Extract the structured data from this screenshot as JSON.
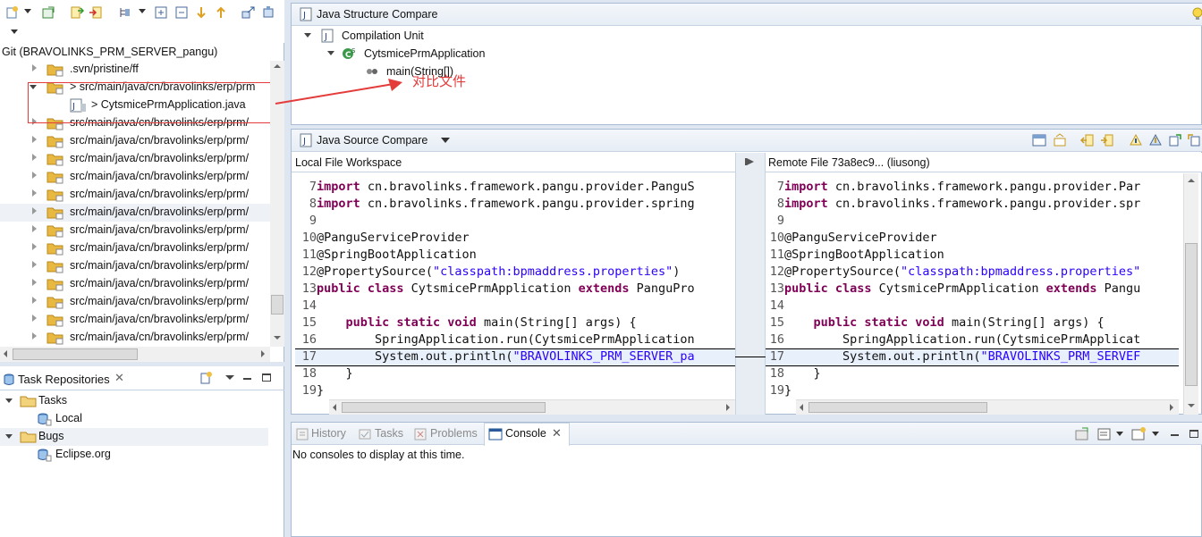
{
  "explorer": {
    "git_title": "Git (BRAVOLINKS_PRM_SERVER_pangu)",
    "rows": [
      {
        "label": ".svn/pristine/ff",
        "expanded": false
      },
      {
        "label": "> src/main/java/cn/bravolinks/erp/prm",
        "expanded": true
      },
      {
        "label": "> CytsmicePrmApplication.java",
        "expanded": false
      },
      {
        "label": "src/main/java/cn/bravolinks/erp/prm/",
        "expanded": false
      },
      {
        "label": "src/main/java/cn/bravolinks/erp/prm/",
        "expanded": false
      },
      {
        "label": "src/main/java/cn/bravolinks/erp/prm/",
        "expanded": false
      },
      {
        "label": "src/main/java/cn/bravolinks/erp/prm/",
        "expanded": false
      },
      {
        "label": "src/main/java/cn/bravolinks/erp/prm/",
        "expanded": false
      },
      {
        "label": "src/main/java/cn/bravolinks/erp/prm/",
        "expanded": false
      },
      {
        "label": "src/main/java/cn/bravolinks/erp/prm/",
        "expanded": false
      },
      {
        "label": "src/main/java/cn/bravolinks/erp/prm/",
        "expanded": false
      },
      {
        "label": "src/main/java/cn/bravolinks/erp/prm/",
        "expanded": false
      },
      {
        "label": "src/main/java/cn/bravolinks/erp/prm/",
        "expanded": false
      },
      {
        "label": "src/main/java/cn/bravolinks/erp/prm/",
        "expanded": false
      },
      {
        "label": "src/main/java/cn/bravolinks/erp/prm/",
        "expanded": false
      },
      {
        "label": "src/main/java/cn/bravolinks/erp/prm/",
        "expanded": false
      }
    ]
  },
  "tasks": {
    "tab_label": "Task Repositories",
    "items": [
      {
        "label": "Tasks",
        "kind": "folder"
      },
      {
        "label": "Local",
        "kind": "repo"
      },
      {
        "label": "Bugs",
        "kind": "folder"
      },
      {
        "label": "Eclipse.org",
        "kind": "repo"
      }
    ]
  },
  "structure": {
    "title": "Java Structure Compare",
    "root": "Compilation Unit",
    "class_name": "CytsmicePrmApplication",
    "method": "main(String[])",
    "annotation": "对比文件"
  },
  "source": {
    "title": "Java Source Compare",
    "left_title": "Local File Workspace",
    "right_title": "Remote File 73a8ec9... (liusong)",
    "left_lines": [
      {
        "n": "7",
        "parts": [
          [
            "kw",
            "import"
          ],
          [
            "t",
            " cn.bravolinks.framework.pangu.provider.PanguS"
          ]
        ]
      },
      {
        "n": "8",
        "parts": [
          [
            "kw",
            "import"
          ],
          [
            "t",
            " cn.bravolinks.framework.pangu.provider.spring"
          ]
        ]
      },
      {
        "n": "9",
        "parts": []
      },
      {
        "n": "10",
        "parts": [
          [
            "t",
            "@PanguServiceProvider"
          ]
        ]
      },
      {
        "n": "11",
        "parts": [
          [
            "t",
            "@SpringBootApplication"
          ]
        ]
      },
      {
        "n": "12",
        "parts": [
          [
            "t",
            "@PropertySource("
          ],
          [
            "str",
            "\"classpath:bpmaddress.properties\""
          ],
          [
            "t",
            ")"
          ]
        ]
      },
      {
        "n": "13",
        "parts": [
          [
            "kw",
            "public class"
          ],
          [
            "t",
            " CytsmicePrmApplication "
          ],
          [
            "kw",
            "extends"
          ],
          [
            "t",
            " PanguPro"
          ]
        ]
      },
      {
        "n": "14",
        "parts": []
      },
      {
        "n": "15",
        "parts": [
          [
            "t",
            "    "
          ],
          [
            "kw",
            "public static void"
          ],
          [
            "t",
            " main(String[] args) {"
          ]
        ]
      },
      {
        "n": "16",
        "parts": [
          [
            "t",
            "        SpringApplication.run(CytsmicePrmApplication"
          ]
        ]
      },
      {
        "n": "17",
        "parts": [
          [
            "t",
            "        System.out.println("
          ],
          [
            "str",
            "\"BRAVOLINKS_PRM_SERVER_pa"
          ]
        ]
      },
      {
        "n": "18",
        "parts": [
          [
            "t",
            "    }"
          ]
        ]
      },
      {
        "n": "19",
        "parts": [
          [
            "t",
            "}"
          ]
        ]
      }
    ],
    "right_lines": [
      {
        "n": "7",
        "parts": [
          [
            "kw",
            "import"
          ],
          [
            "t",
            " cn.bravolinks.framework.pangu.provider.Par"
          ]
        ]
      },
      {
        "n": "8",
        "parts": [
          [
            "kw",
            "import"
          ],
          [
            "t",
            " cn.bravolinks.framework.pangu.provider.spr"
          ]
        ]
      },
      {
        "n": "9",
        "parts": []
      },
      {
        "n": "10",
        "parts": [
          [
            "t",
            "@PanguServiceProvider"
          ]
        ]
      },
      {
        "n": "11",
        "parts": [
          [
            "t",
            "@SpringBootApplication"
          ]
        ]
      },
      {
        "n": "12",
        "parts": [
          [
            "t",
            "@PropertySource("
          ],
          [
            "str",
            "\"classpath:bpmaddress.properties\""
          ]
        ]
      },
      {
        "n": "13",
        "parts": [
          [
            "kw",
            "public class"
          ],
          [
            "t",
            " CytsmicePrmApplication "
          ],
          [
            "kw",
            "extends"
          ],
          [
            "t",
            " Pangu"
          ]
        ]
      },
      {
        "n": "14",
        "parts": []
      },
      {
        "n": "15",
        "parts": [
          [
            "t",
            "    "
          ],
          [
            "kw",
            "public static void"
          ],
          [
            "t",
            " main(String[] args) {"
          ]
        ]
      },
      {
        "n": "16",
        "parts": [
          [
            "t",
            "        SpringApplication.run(CytsmicePrmApplicat"
          ]
        ]
      },
      {
        "n": "17",
        "parts": [
          [
            "t",
            "        System.out.println("
          ],
          [
            "str",
            "\"BRAVOLINKS_PRM_SERVEF"
          ]
        ]
      },
      {
        "n": "18",
        "parts": [
          [
            "t",
            "    }"
          ]
        ]
      },
      {
        "n": "19",
        "parts": [
          [
            "t",
            "}"
          ]
        ]
      }
    ]
  },
  "console": {
    "tabs": [
      "History",
      "Tasks",
      "Problems",
      "Console"
    ],
    "active_tab": "Console",
    "message": "No consoles to display at this time."
  },
  "colors": {
    "keyword": "#7f0055",
    "string": "#2a00ff",
    "annotation": "#e43b3b",
    "folder": "#e8b840"
  }
}
